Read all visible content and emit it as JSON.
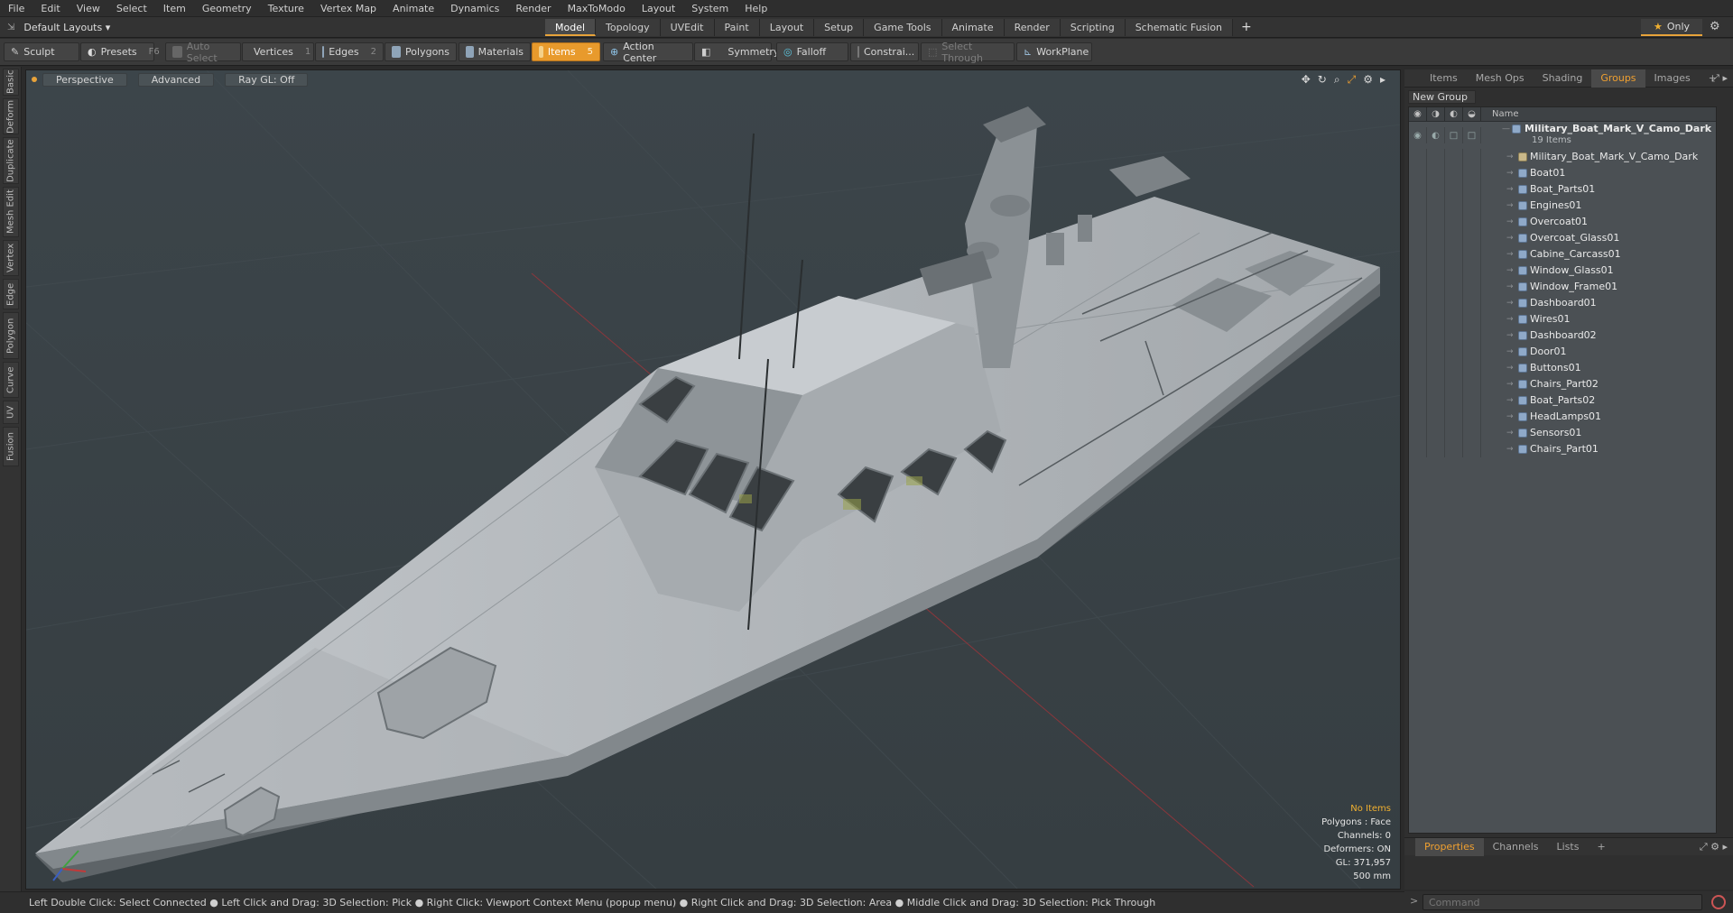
{
  "menu": [
    "File",
    "Edit",
    "View",
    "Select",
    "Item",
    "Geometry",
    "Texture",
    "Vertex Map",
    "Animate",
    "Dynamics",
    "Render",
    "MaxToModo",
    "Layout",
    "System",
    "Help"
  ],
  "layout": {
    "selector": "Default Layouts ▾",
    "tabs": [
      "Model",
      "Topology",
      "UVEdit",
      "Paint",
      "Layout",
      "Setup",
      "Game Tools",
      "Animate",
      "Render",
      "Scripting",
      "Schematic Fusion"
    ],
    "active_tab": "Model",
    "only_label": "Only"
  },
  "toolbar": {
    "sculpt": "Sculpt",
    "presets": "Presets",
    "presets_key": "F6",
    "auto_select": "Auto Select",
    "vertices": "Vertices",
    "vertices_key": "1",
    "edges": "Edges",
    "edges_key": "2",
    "polygons": "Polygons",
    "materials": "Materials",
    "items": "Items",
    "items_key": "5",
    "action_center": "Action Center",
    "symmetry": "Symmetry",
    "falloff": "Falloff",
    "constraints": "Constrai...",
    "select_through": "Select Through",
    "workplane": "WorkPlane"
  },
  "left_tabs": [
    "Basic",
    "Deform",
    "Duplicate",
    "Mesh Edit",
    "Vertex",
    "Edge",
    "Polygon",
    "Curve",
    "UV",
    "Fusion"
  ],
  "viewport": {
    "view": "Perspective",
    "shading": "Advanced",
    "raygl": "Ray GL: Off",
    "stats": {
      "selection": "No Items",
      "polygons": "Polygons : Face",
      "channels": "Channels: 0",
      "deformers": "Deformers: ON",
      "gl": "GL: 371,957",
      "scale": "500 mm"
    }
  },
  "right_panel": {
    "tabs": [
      "Items",
      "Mesh Ops",
      "Shading",
      "Groups",
      "Images"
    ],
    "active_tab": "Groups",
    "new_group": "New Group",
    "column_name": "Name",
    "group": {
      "name": "Military_Boat_Mark_V_Camo_Dark ...",
      "count": "19 Items"
    },
    "items": [
      "Military_Boat_Mark_V_Camo_Dark",
      "Boat01",
      "Boat_Parts01",
      "Engines01",
      "Overcoat01",
      "Overcoat_Glass01",
      "Cabine_Carcass01",
      "Window_Glass01",
      "Window_Frame01",
      "Dashboard01",
      "Wires01",
      "Dashboard02",
      "Door01",
      "Buttons01",
      "Chairs_Part02",
      "Boat_Parts02",
      "HeadLamps01",
      "Sensors01",
      "Chairs_Part01"
    ],
    "bottom_tabs": [
      "Properties",
      "Channels",
      "Lists"
    ],
    "bottom_active": "Properties"
  },
  "command": {
    "placeholder": "Command"
  },
  "status": "Left Double Click: Select Connected ● Left Click and Drag: 3D Selection: Pick ● Right Click: Viewport Context Menu (popup menu) ● Right Click and Drag: 3D Selection: Area ● Middle Click and Drag: 3D Selection: Pick Through"
}
